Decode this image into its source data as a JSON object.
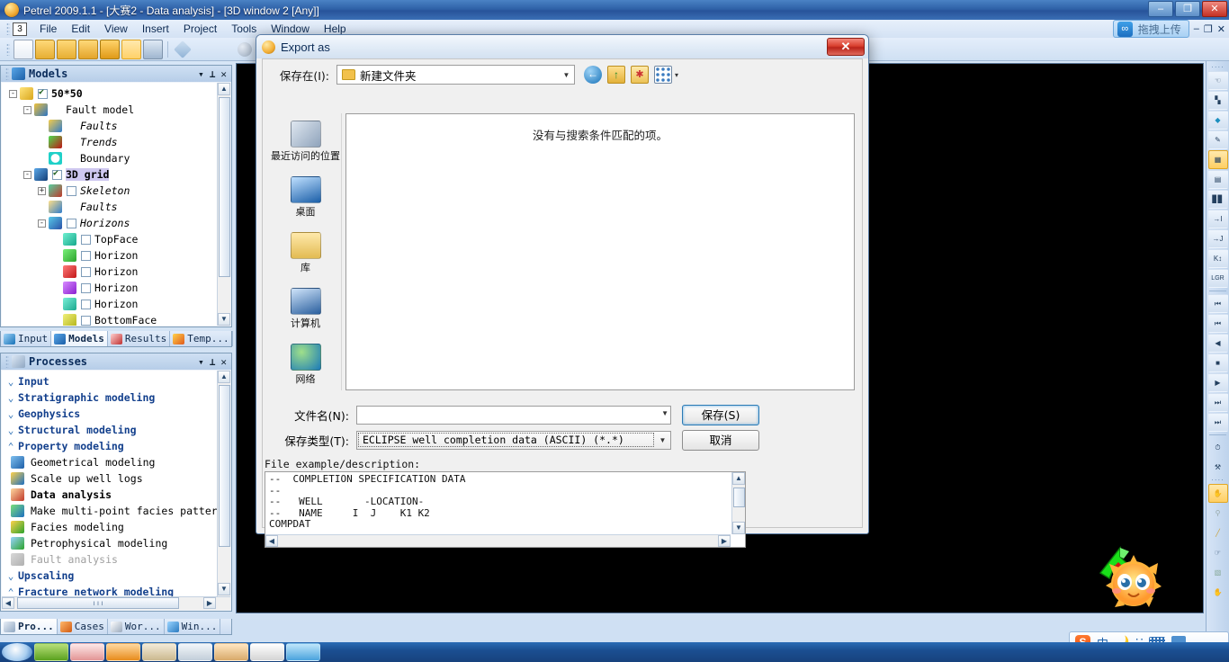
{
  "window": {
    "title": "Petrel 2009.1.1 - [大赛2 - Data analysis] - [3D window 2 [Any]]",
    "minimize": "–",
    "maximize": "❐",
    "close": "✕",
    "mdi_min": "–",
    "mdi_restore": "❐",
    "mdi_close": "✕"
  },
  "menubar": {
    "badge": "3",
    "items": [
      "File",
      "Edit",
      "View",
      "Insert",
      "Project",
      "Tools",
      "Window",
      "Help"
    ]
  },
  "upload_button": {
    "label": "拖拽上传"
  },
  "models_panel": {
    "title": "Models",
    "dropdown_icon": "▾",
    "pin_icon": "⊥",
    "close_icon": "✕",
    "tree": [
      {
        "depth": 0,
        "expander": "-",
        "check": "on",
        "label": "50*50",
        "style": "bd",
        "icon": "cube-icon"
      },
      {
        "depth": 1,
        "expander": "-",
        "check": "none",
        "label": "Fault model",
        "style": "",
        "icon": "fault-model-icon"
      },
      {
        "depth": 2,
        "expander": "",
        "check": "none",
        "label": "Faults",
        "style": "it",
        "icon": "faults-icon"
      },
      {
        "depth": 2,
        "expander": "",
        "check": "none",
        "label": "Trends",
        "style": "it",
        "icon": "trends-icon"
      },
      {
        "depth": 2,
        "expander": "",
        "check": "none",
        "label": "Boundary",
        "style": "",
        "icon": "boundary-icon"
      },
      {
        "depth": 1,
        "expander": "-",
        "check": "on",
        "label": "3D grid",
        "style": "bd sel",
        "icon": "grid-icon"
      },
      {
        "depth": 2,
        "expander": "+",
        "check": "off",
        "label": "Skeleton",
        "style": "it",
        "icon": "skeleton-icon"
      },
      {
        "depth": 2,
        "expander": "",
        "check": "none",
        "label": "Faults",
        "style": "it",
        "icon": "grid-faults-icon"
      },
      {
        "depth": 2,
        "expander": "-",
        "check": "off",
        "label": "Horizons",
        "style": "it",
        "icon": "horizons-icon"
      },
      {
        "depth": 3,
        "expander": "",
        "check": "off",
        "label": "TopFace",
        "style": "",
        "icon": "horizon-teal-icon"
      },
      {
        "depth": 3,
        "expander": "",
        "check": "off",
        "label": "Horizon",
        "style": "",
        "icon": "horizon-green-icon"
      },
      {
        "depth": 3,
        "expander": "",
        "check": "off",
        "label": "Horizon",
        "style": "",
        "icon": "horizon-red-icon"
      },
      {
        "depth": 3,
        "expander": "",
        "check": "off",
        "label": "Horizon",
        "style": "",
        "icon": "horizon-purple-icon"
      },
      {
        "depth": 3,
        "expander": "",
        "check": "off",
        "label": "Horizon",
        "style": "",
        "icon": "horizon-teal2-icon"
      },
      {
        "depth": 3,
        "expander": "",
        "check": "off",
        "label": "BottomFace",
        "style": "",
        "icon": "horizon-yellow-icon"
      }
    ],
    "tabs": [
      {
        "label": "Input",
        "icon": "input-icon",
        "active": false
      },
      {
        "label": "Models",
        "icon": "models-icon",
        "active": true
      },
      {
        "label": "Results",
        "icon": "results-icon",
        "active": false
      },
      {
        "label": "Temp...",
        "icon": "templates-icon",
        "active": false
      }
    ]
  },
  "processes_panel": {
    "title": "Processes",
    "dropdown_icon": "▾",
    "pin_icon": "⊥",
    "close_icon": "✕",
    "items": [
      {
        "kind": "group",
        "state": "collapsed",
        "label": "Input"
      },
      {
        "kind": "group",
        "state": "collapsed",
        "label": "Stratigraphic modeling"
      },
      {
        "kind": "group",
        "state": "collapsed",
        "label": "Geophysics"
      },
      {
        "kind": "group",
        "state": "collapsed",
        "label": "Structural modeling"
      },
      {
        "kind": "group",
        "state": "expanded",
        "label": "Property modeling"
      },
      {
        "kind": "item",
        "label": "Geometrical modeling",
        "icon": "geometrical-modeling-icon",
        "style": ""
      },
      {
        "kind": "item",
        "label": "Scale up well logs",
        "icon": "scale-up-well-logs-icon",
        "style": ""
      },
      {
        "kind": "item",
        "label": "Data analysis",
        "icon": "data-analysis-icon",
        "style": "bd"
      },
      {
        "kind": "item",
        "label": "Make multi-point facies pattern",
        "icon": "multipoint-facies-icon",
        "style": ""
      },
      {
        "kind": "item",
        "label": "Facies modeling",
        "icon": "facies-modeling-icon",
        "style": ""
      },
      {
        "kind": "item",
        "label": "Petrophysical modeling",
        "icon": "petrophysical-modeling-icon",
        "style": ""
      },
      {
        "kind": "item",
        "label": "Fault analysis",
        "icon": "fault-analysis-icon",
        "style": "dim"
      },
      {
        "kind": "group",
        "state": "collapsed",
        "label": "Upscaling"
      },
      {
        "kind": "group",
        "state": "expanded",
        "label": "Fracture network modeling"
      }
    ],
    "tabs": [
      {
        "label": "Pro...",
        "icon": "processes-icon",
        "active": true
      },
      {
        "label": "Cases",
        "icon": "cases-icon",
        "active": false
      },
      {
        "label": "Wor...",
        "icon": "workflow-icon",
        "active": false
      },
      {
        "label": "Win...",
        "icon": "windows-icon",
        "active": false
      }
    ]
  },
  "dialog": {
    "title": "Export as",
    "close_label": "✕",
    "look_in_label": "保存在(I):",
    "look_in_value": "新建文件夹",
    "nav_icons": [
      "back-icon",
      "up-folder-icon",
      "new-folder-icon",
      "views-icon"
    ],
    "views_caret": "▾",
    "empty_message": "没有与搜索条件匹配的项。",
    "places": [
      {
        "label": "最近访问的位置",
        "icon": "recent-places-icon"
      },
      {
        "label": "桌面",
        "icon": "desktop-icon"
      },
      {
        "label": "库",
        "icon": "libraries-icon"
      },
      {
        "label": "计算机",
        "icon": "computer-icon"
      },
      {
        "label": "网络",
        "icon": "network-icon"
      }
    ],
    "file_name_label": "文件名(N):",
    "file_name_value": "",
    "file_type_label": "保存类型(T):",
    "file_type_value": "ECLIPSE well completion data (ASCII) (*.*)",
    "save_button": "保存(S)",
    "cancel_button": "取消",
    "example_label": "File example/description:",
    "example_text": "--  COMPLETION SPECIFICATION DATA\n--\n--   WELL       -LOCATION-\n--   NAME     I  J    K1 K2\nCOMPDAT\n---------------------------"
  },
  "right_toolbar": {
    "buttons": [
      {
        "icon": "select-pointer-icon",
        "state": "normal"
      },
      {
        "icon": "histogram-icon",
        "state": "normal"
      },
      {
        "icon": "gem-icon",
        "state": "normal"
      },
      {
        "icon": "edit-tools-icon",
        "state": "normal"
      },
      {
        "icon": "grid-cells-icon",
        "state": "selected"
      },
      {
        "icon": "grid-3d-icon",
        "state": "normal"
      },
      {
        "icon": "well-logs-icon",
        "state": "normal"
      },
      {
        "icon": "i-direction-icon",
        "state": "normal",
        "text": "I"
      },
      {
        "icon": "j-direction-icon",
        "state": "normal",
        "text": "J"
      },
      {
        "icon": "k-direction-icon",
        "state": "normal",
        "text": "K"
      },
      {
        "icon": "lgr-icon",
        "state": "normal",
        "text": "LGR"
      },
      {
        "icon": "skip-first-icon",
        "state": "normal"
      },
      {
        "icon": "step-back-icon",
        "state": "normal"
      },
      {
        "icon": "play-back-icon",
        "state": "normal"
      },
      {
        "icon": "stop-icon",
        "state": "normal"
      },
      {
        "icon": "play-icon",
        "state": "normal"
      },
      {
        "icon": "step-forward-icon",
        "state": "normal"
      },
      {
        "icon": "skip-last-icon",
        "state": "normal"
      },
      {
        "icon": "clock-icon",
        "state": "normal"
      },
      {
        "icon": "wrench-icon",
        "state": "normal"
      },
      {
        "icon": "pan-hand-icon",
        "state": "selected"
      },
      {
        "icon": "magnifier-icon",
        "state": "normal"
      },
      {
        "icon": "measure-ruler-icon",
        "state": "normal"
      },
      {
        "icon": "arrow-cursor-icon",
        "state": "normal"
      },
      {
        "icon": "picture-icon",
        "state": "normal"
      },
      {
        "icon": "hand-draw-icon",
        "state": "normal"
      }
    ]
  },
  "ime": {
    "logo": "S",
    "mode": "中",
    "moon_icon": "🌙",
    "comma_icon": "∵",
    "keyboard_icon": "keyboard-icon"
  },
  "viewport": {
    "axis_widget": "green-axis-arrow",
    "mascot": "sun-mascot"
  }
}
